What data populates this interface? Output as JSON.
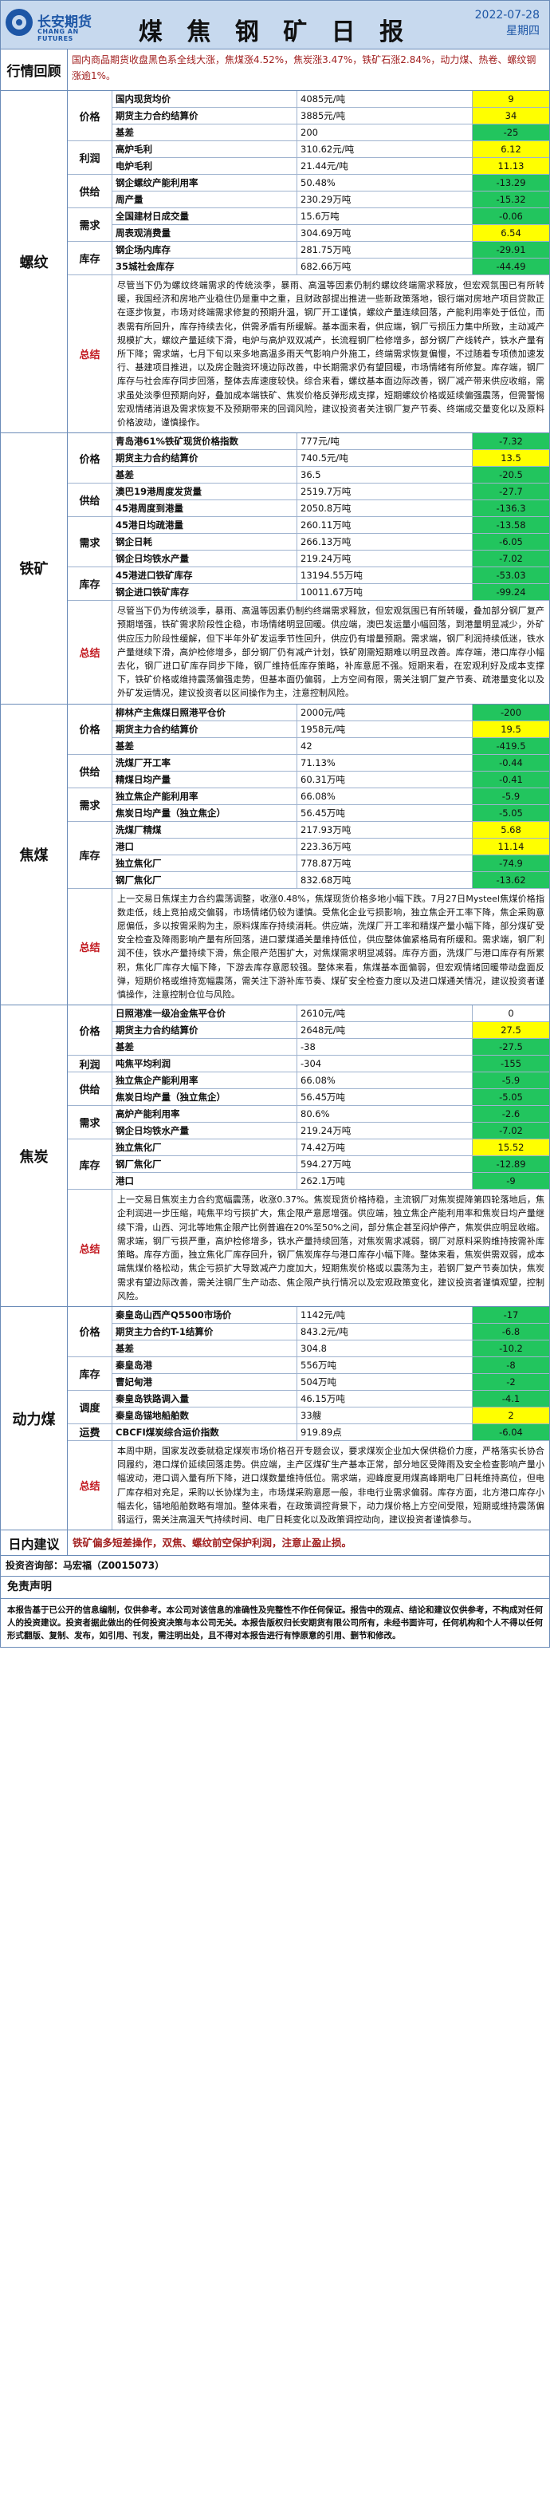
{
  "header": {
    "logo_cn": "长安期货",
    "logo_en": "CHANG AN FUTURES",
    "title": "煤 焦 钢 矿 日 报",
    "date": "2022-07-28",
    "weekday": "星期四"
  },
  "review": {
    "label": "行情回顾",
    "text": "国内商品期货收盘黑色系全线大涨，焦煤涨4.52%，焦炭涨3.47%，铁矿石涨2.84%，动力煤、热卷、螺纹钢涨逾1%。"
  },
  "sections": [
    {
      "id": "rebar",
      "label": "螺纹",
      "groups": [
        {
          "cat": "价格",
          "rows": [
            {
              "name": "国内现货均价",
              "value": "4085元/吨",
              "change": "9",
              "sign": "pos"
            },
            {
              "name": "期货主力合约结算价",
              "value": "3885元/吨",
              "change": "34",
              "sign": "pos"
            },
            {
              "name": "基差",
              "value": "200",
              "change": "-25",
              "sign": "neg"
            }
          ]
        },
        {
          "cat": "利润",
          "rows": [
            {
              "name": "高炉毛利",
              "value": "310.62元/吨",
              "change": "6.12",
              "sign": "pos"
            },
            {
              "name": "电炉毛利",
              "value": "21.44元/吨",
              "change": "11.13",
              "sign": "pos"
            }
          ]
        },
        {
          "cat": "供给",
          "rows": [
            {
              "name": "钢企螺纹产能利用率",
              "value": "50.48%",
              "change": "-13.29",
              "sign": "neg"
            },
            {
              "name": "周产量",
              "value": "230.29万吨",
              "change": "-15.32",
              "sign": "neg"
            }
          ]
        },
        {
          "cat": "需求",
          "rows": [
            {
              "name": "全国建材日成交量",
              "value": "15.6万吨",
              "change": "-0.06",
              "sign": "neg"
            },
            {
              "name": "周表观消费量",
              "value": "304.69万吨",
              "change": "6.54",
              "sign": "pos"
            }
          ]
        },
        {
          "cat": "库存",
          "rows": [
            {
              "name": "钢企场内库存",
              "value": "281.75万吨",
              "change": "-29.91",
              "sign": "neg"
            },
            {
              "name": "35城社会库存",
              "value": "682.66万吨",
              "change": "-44.49",
              "sign": "neg"
            }
          ]
        }
      ],
      "summary_label": "总结",
      "summary": "尽管当下仍为螺纹终端需求的传统淡季，暴雨、高温等因素仍制约螺纹终端需求释放，但宏观氛围已有所转暖，我国经济和房地产业稳住仍是重中之重，且财政部提出推进一些新政策落地，银行端对房地产项目贷款正在逐步恢复，市场对终端需求修复的预期升温，钢厂开工谨慎，螺纹产量连续回落，产能利用率处于低位，而表需有所回升，库存持续去化，供需矛盾有所缓解。基本面来看，供应端，钢厂亏损压力集中所致，主动减产规模扩大，螺纹产量延续下滑，电炉与高炉双双减产，长流程钢厂检修增多，部分钢厂产线转产，铁水产量有所下降；需求端，七月下旬以来多地高温多雨天气影响户外施工，终端需求恢复偏慢，不过随着专项债加速发行、基建项目推进，以及房企融资环境边际改善，中长期需求仍有望回暖，市场情绪有所修复。库存端，钢厂库存与社会库存同步回落，整体去库速度较快。综合来看，螺纹基本面边际改善，钢厂减产带来供应收缩，需求虽处淡季但预期向好，叠加成本端铁矿、焦炭价格反弹形成支撑，短期螺纹价格或延续偏强震荡，但需警惕宏观情绪消退及需求恢复不及预期带来的回调风险，建议投资者关注钢厂复产节奏、终端成交量变化以及原料价格波动，谨慎操作。"
    },
    {
      "id": "iron-ore",
      "label": "铁矿",
      "groups": [
        {
          "cat": "价格",
          "rows": [
            {
              "name": "青岛港61%铁矿现货价格指数",
              "value": "777元/吨",
              "change": "-7.32",
              "sign": "neg"
            },
            {
              "name": "期货主力合约结算价",
              "value": "740.5元/吨",
              "change": "13.5",
              "sign": "pos"
            },
            {
              "name": "基差",
              "value": "36.5",
              "change": "-20.5",
              "sign": "neg"
            }
          ]
        },
        {
          "cat": "供给",
          "rows": [
            {
              "name": "澳巴19港周度发货量",
              "value": "2519.7万吨",
              "change": "-27.7",
              "sign": "neg"
            },
            {
              "name": "45港周度到港量",
              "value": "2050.8万吨",
              "change": "-136.3",
              "sign": "neg"
            }
          ]
        },
        {
          "cat": "需求",
          "rows": [
            {
              "name": "45港日均疏港量",
              "value": "260.11万吨",
              "change": "-13.58",
              "sign": "neg"
            },
            {
              "name": "钢企日耗",
              "value": "266.13万吨",
              "change": "-6.05",
              "sign": "neg"
            },
            {
              "name": "钢企日均铁水产量",
              "value": "219.24万吨",
              "change": "-7.02",
              "sign": "neg"
            }
          ]
        },
        {
          "cat": "库存",
          "rows": [
            {
              "name": "45港进口铁矿库存",
              "value": "13194.55万吨",
              "change": "-53.03",
              "sign": "neg"
            },
            {
              "name": "钢企进口铁矿库存",
              "value": "10011.67万吨",
              "change": "-99.24",
              "sign": "neg"
            }
          ]
        }
      ],
      "summary_label": "总结",
      "summary": "尽管当下仍为传统淡季，暴雨、高温等因素仍制约终端需求释放，但宏观氛围已有所转暖，叠加部分钢厂复产预期增强，铁矿需求阶段性企稳，市场情绪明显回暖。供应端，澳巴发运量小幅回落，到港量明显减少，外矿供应压力阶段性缓解，但下半年外矿发运季节性回升，供应仍有增量预期。需求端，钢厂利润持续低迷，铁水产量继续下滑，高炉检修增多，部分钢厂仍有减产计划，铁矿刚需短期难以明显改善。库存端，港口库存小幅去化，钢厂进口矿库存同步下降，钢厂维持低库存策略，补库意愿不强。短期来看，在宏观利好及成本支撑下，铁矿价格或维持震荡偏强走势，但基本面仍偏弱，上方空间有限，需关注钢厂复产节奏、疏港量变化以及外矿发运情况，建议投资者以区间操作为主，注意控制风险。"
    },
    {
      "id": "coking-coal",
      "label": "焦煤",
      "groups": [
        {
          "cat": "价格",
          "rows": [
            {
              "name": "柳林产主焦煤日照港平仓价",
              "value": "2000元/吨",
              "change": "-200",
              "sign": "neg"
            },
            {
              "name": "期货主力合约结算价",
              "value": "1958元/吨",
              "change": "19.5",
              "sign": "pos"
            },
            {
              "name": "基差",
              "value": "42",
              "change": "-419.5",
              "sign": "neg"
            }
          ]
        },
        {
          "cat": "供给",
          "rows": [
            {
              "name": "洗煤厂开工率",
              "value": "71.13%",
              "change": "-0.44",
              "sign": "neg"
            },
            {
              "name": "精煤日均产量",
              "value": "60.31万吨",
              "change": "-0.41",
              "sign": "neg"
            }
          ]
        },
        {
          "cat": "需求",
          "rows": [
            {
              "name": "独立焦企产能利用率",
              "value": "66.08%",
              "change": "-5.9",
              "sign": "neg"
            },
            {
              "name": "焦炭日均产量（独立焦企）",
              "value": "56.45万吨",
              "change": "-5.05",
              "sign": "neg"
            }
          ]
        },
        {
          "cat": "库存",
          "rows": [
            {
              "name": "洗煤厂精煤",
              "value": "217.93万吨",
              "change": "5.68",
              "sign": "pos"
            },
            {
              "name": "港口",
              "value": "223.36万吨",
              "change": "11.14",
              "sign": "pos"
            },
            {
              "name": "独立焦化厂",
              "value": "778.87万吨",
              "change": "-74.9",
              "sign": "neg"
            },
            {
              "name": "钢厂焦化厂",
              "value": "832.68万吨",
              "change": "-13.62",
              "sign": "neg"
            }
          ]
        }
      ],
      "summary_label": "总结",
      "summary": "上一交易日焦煤主力合约震荡调整，收涨0.48%，焦煤现货价格多地小幅下跌。7月27日Mysteel焦煤价格指数走低，线上竞拍成交偏弱，市场情绪仍较为谨慎。受焦化企业亏损影响，独立焦企开工率下降，焦企采购意愿偏低，多以按需采购为主，原料煤库存持续消耗。供应端，洗煤厂开工率和精煤产量小幅下降，部分煤矿受安全检查及降雨影响产量有所回落，进口蒙煤通关量维持低位，供应整体偏紧格局有所缓和。需求端，钢厂利润不佳，铁水产量持续下滑，焦企限产范围扩大，对焦煤需求明显减弱。库存方面，洗煤厂与港口库存有所累积，焦化厂库存大幅下降，下游去库存意愿较强。整体来看，焦煤基本面偏弱，但宏观情绪回暖带动盘面反弹，短期价格或维持宽幅震荡，需关注下游补库节奏、煤矿安全检查力度以及进口煤通关情况，建议投资者谨慎操作，注意控制仓位与风险。"
    },
    {
      "id": "coke",
      "label": "焦炭",
      "groups": [
        {
          "cat": "价格",
          "rows": [
            {
              "name": "日照港准一级冶金焦平仓价",
              "value": "2610元/吨",
              "change": "0",
              "sign": "none"
            },
            {
              "name": "期货主力合约结算价",
              "value": "2648元/吨",
              "change": "27.5",
              "sign": "pos"
            },
            {
              "name": "基差",
              "value": "-38",
              "change": "-27.5",
              "sign": "neg"
            }
          ]
        },
        {
          "cat": "利润",
          "rows": [
            {
              "name": "吨焦平均利润",
              "value": "-304",
              "change": "-155",
              "sign": "neg"
            }
          ]
        },
        {
          "cat": "供给",
          "rows": [
            {
              "name": "独立焦企产能利用率",
              "value": "66.08%",
              "change": "-5.9",
              "sign": "neg"
            },
            {
              "name": "焦炭日均产量（独立焦企）",
              "value": "56.45万吨",
              "change": "-5.05",
              "sign": "neg"
            }
          ]
        },
        {
          "cat": "需求",
          "rows": [
            {
              "name": "高炉产能利用率",
              "value": "80.6%",
              "change": "-2.6",
              "sign": "neg"
            },
            {
              "name": "钢企日均铁水产量",
              "value": "219.24万吨",
              "change": "-7.02",
              "sign": "neg"
            }
          ]
        },
        {
          "cat": "库存",
          "rows": [
            {
              "name": "独立焦化厂",
              "value": "74.42万吨",
              "change": "15.52",
              "sign": "pos"
            },
            {
              "name": "钢厂焦化厂",
              "value": "594.27万吨",
              "change": "-12.89",
              "sign": "neg"
            },
            {
              "name": "港口",
              "value": "262.1万吨",
              "change": "-9",
              "sign": "neg"
            }
          ]
        }
      ],
      "summary_label": "总结",
      "summary": "上一交易日焦炭主力合约宽幅震荡，收涨0.37%。焦炭现货价格持稳，主流钢厂对焦炭提降第四轮落地后，焦企利润进一步压缩，吨焦平均亏损扩大，焦企限产意愿增强。供应端，独立焦企产能利用率和焦炭日均产量继续下滑，山西、河北等地焦企限产比例普遍在20%至50%之间，部分焦企甚至闷炉停产，焦炭供应明显收缩。需求端，钢厂亏损严重，高炉检修增多，铁水产量持续回落，对焦炭需求减弱，钢厂对原料采购维持按需补库策略。库存方面，独立焦化厂库存回升，钢厂焦炭库存与港口库存小幅下降。整体来看，焦炭供需双弱，成本端焦煤价格松动，焦企亏损扩大导致减产力度加大，短期焦炭价格或以震荡为主，若钢厂复产节奏加快，焦炭需求有望边际改善，需关注钢厂生产动态、焦企限产执行情况以及宏观政策变化，建议投资者谨慎观望，控制风险。"
    },
    {
      "id": "thermal-coal",
      "label": "动力煤",
      "groups": [
        {
          "cat": "价格",
          "rows": [
            {
              "name": "秦皇岛山西产Q5500市场价",
              "value": "1142元/吨",
              "change": "-17",
              "sign": "neg"
            },
            {
              "name": "期货主力合约T-1结算价",
              "value": "843.2元/吨",
              "change": "-6.8",
              "sign": "neg"
            },
            {
              "name": "基差",
              "value": "304.8",
              "change": "-10.2",
              "sign": "neg"
            }
          ]
        },
        {
          "cat": "库存",
          "rows": [
            {
              "name": "秦皇岛港",
              "value": "556万吨",
              "change": "-8",
              "sign": "neg"
            },
            {
              "name": "曹妃甸港",
              "value": "504万吨",
              "change": "-2",
              "sign": "neg"
            }
          ]
        },
        {
          "cat": "调度",
          "rows": [
            {
              "name": "秦皇岛铁路调入量",
              "value": "46.15万吨",
              "change": "-4.1",
              "sign": "neg"
            },
            {
              "name": "秦皇岛锚地船舶数",
              "value": "33艘",
              "change": "2",
              "sign": "pos"
            }
          ]
        },
        {
          "cat": "运费",
          "rows": [
            {
              "name": "CBCFI煤炭综合运价指数",
              "value": "919.89点",
              "change": "-6.04",
              "sign": "neg"
            }
          ]
        }
      ],
      "summary_label": "总结",
      "summary": "本周中期，国家发改委就稳定煤炭市场价格召开专题会议，要求煤炭企业加大保供稳价力度，严格落实长协合同履约，港口煤价延续回落走势。供应端，主产区煤矿生产基本正常，部分地区受降雨及安全检查影响产量小幅波动，港口调入量有所下降，进口煤数量维持低位。需求端，迎峰度夏用煤高峰期电厂日耗维持高位，但电厂库存相对充足，采购以长协煤为主，市场煤采购意愿一般，非电行业需求偏弱。库存方面，北方港口库存小幅去化，锚地船舶数略有增加。整体来看，在政策调控背景下，动力煤价格上方空间受限，短期或维持震荡偏弱运行，需关注高温天气持续时间、电厂日耗变化以及政策调控动向，建议投资者谨慎参与。"
    }
  ],
  "advice": {
    "label": "日内建议",
    "text": "铁矿偏多短差操作，双焦、螺纹前空保护利润，注意止盈止损。"
  },
  "analyst": "投资咨询部：马宏福（Z0015073）",
  "disclaimer": {
    "title": "免责声明",
    "text": "本报告基于已公开的信息编制，仅供参考。本公司对该信息的准确性及完整性不作任何保证。报告中的观点、结论和建议仅供参考，不构成对任何人的投资建议。投资者据此做出的任何投资决策与本公司无关。本报告版权归长安期货有限公司所有，未经书面许可，任何机构和个人不得以任何形式翻版、复制、发布，如引用、刊发，需注明出处，且不得对本报告进行有悖原意的引用、删节和修改。"
  }
}
